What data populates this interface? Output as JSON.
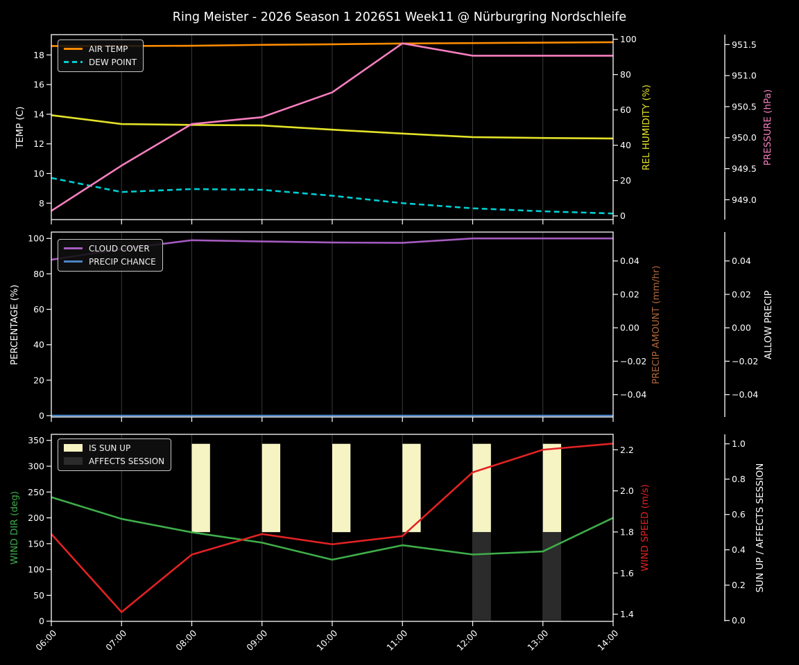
{
  "title": "Ring Meister - 2026 Season 1 2026S1 Week11 @ Nürburgring Nordschleife",
  "x_labels": [
    "06:00",
    "07:00",
    "08:00",
    "09:00",
    "10:00",
    "11:00",
    "12:00",
    "13:00",
    "14:00"
  ],
  "colors": {
    "background": "#000000",
    "foreground": "#ffffff",
    "grid": "#3a3a3a",
    "air_temp": "#ff8c00",
    "dew_point": "#00ced1",
    "rel_humidity": "#e3e328",
    "pressure": "#f77fbf",
    "cloud_cover": "#a55bc0",
    "precip_chance": "#4a85c7",
    "precip_amount": "#b0663a",
    "wind_dir": "#3fae4a",
    "wind_speed": "#e32222",
    "is_sun_up": "#f7f4c4",
    "affects_session": "#2b2b2b"
  },
  "chart_data": [
    {
      "type": "line",
      "panel": "temperature-humidity-pressure",
      "x": [
        "06:00",
        "07:00",
        "08:00",
        "09:00",
        "10:00",
        "11:00",
        "12:00",
        "13:00",
        "14:00"
      ],
      "legend": [
        {
          "label": "AIR TEMP",
          "swatch": "line",
          "color": "#ff8c00"
        },
        {
          "label": "DEW POINT",
          "swatch": "dashed",
          "color": "#00ced1"
        }
      ],
      "left_axis": {
        "title": "TEMP (C)",
        "title_color": "#ffffff",
        "tick_labels": [
          "8",
          "10",
          "12",
          "14",
          "16",
          "18"
        ],
        "tick_values": [
          8,
          10,
          12,
          14,
          16,
          18
        ],
        "range": [
          6.89,
          19.37
        ]
      },
      "right_axis1": {
        "title": "REL HUMIDITY (%)",
        "title_color": "#e3e328",
        "tick_labels": [
          "0",
          "20",
          "40",
          "60",
          "80",
          "100"
        ],
        "tick_values": [
          0,
          20,
          40,
          60,
          80,
          100
        ],
        "range": [
          -2.08,
          102.6
        ]
      },
      "right_axis2": {
        "title": "PRESSURE (hPa)",
        "title_color": "#f77fbf",
        "tick_labels": [
          "949.0",
          "949.5",
          "950.0",
          "950.5",
          "951.0",
          "951.5"
        ],
        "tick_values": [
          949.0,
          949.5,
          950.0,
          950.5,
          951.0,
          951.5
        ],
        "range": [
          948.68,
          951.66
        ]
      },
      "series": [
        {
          "name": "AIR TEMP",
          "axis": "left",
          "color": "#ff8c00",
          "dash": false,
          "values": [
            18.6,
            18.6,
            18.62,
            18.68,
            18.72,
            18.77,
            18.8,
            18.83,
            18.86
          ]
        },
        {
          "name": "DEW POINT",
          "axis": "left",
          "color": "#00ced1",
          "dash": true,
          "values": [
            9.7,
            8.75,
            8.95,
            8.9,
            8.5,
            8.0,
            7.65,
            7.45,
            7.3
          ]
        },
        {
          "name": "REL HUMIDITY",
          "axis": "right1",
          "color": "#e3e328",
          "dash": false,
          "values": [
            57,
            52,
            51.5,
            51.2,
            48.8,
            46.6,
            44.6,
            44.1,
            43.8
          ]
        },
        {
          "name": "PRESSURE",
          "axis": "right2",
          "color": "#f77fbf",
          "dash": false,
          "values": [
            948.82,
            949.55,
            950.22,
            950.33,
            950.73,
            951.52,
            951.32,
            951.32,
            951.32
          ]
        }
      ]
    },
    {
      "type": "line",
      "panel": "cloud-precip",
      "x": [
        "06:00",
        "07:00",
        "08:00",
        "09:00",
        "10:00",
        "11:00",
        "12:00",
        "13:00",
        "14:00"
      ],
      "legend": [
        {
          "label": "CLOUD COVER",
          "swatch": "line",
          "color": "#a55bc0"
        },
        {
          "label": "PRECIP CHANCE",
          "swatch": "line",
          "color": "#4a85c7"
        }
      ],
      "left_axis": {
        "title": "PERCENTAGE (%)",
        "title_color": "#ffffff",
        "tick_labels": [
          "0",
          "20",
          "40",
          "60",
          "80",
          "100"
        ],
        "tick_values": [
          0,
          20,
          40,
          60,
          80,
          100
        ],
        "range": [
          -0.78,
          103.6
        ]
      },
      "right_axis1": {
        "title": "PRECIP AMOUNT (mm/hr)",
        "title_color": "#b0663a",
        "tick_labels": [
          "−0.04",
          "−0.02",
          "0.00",
          "0.02",
          "0.04"
        ],
        "tick_values": [
          -0.04,
          -0.02,
          0,
          0.02,
          0.04
        ],
        "range": [
          -0.0534,
          0.0573
        ]
      },
      "right_axis2": {
        "title": "ALLOW PRECIP",
        "title_color": "#ffffff",
        "tick_labels": [
          "−0.04",
          "−0.02",
          "0.00",
          "0.02",
          "0.04"
        ],
        "tick_values": [
          -0.04,
          -0.02,
          0,
          0.02,
          0.04
        ],
        "range": [
          -0.0534,
          0.0573
        ]
      },
      "series": [
        {
          "name": "CLOUD COVER",
          "axis": "left",
          "color": "#a55bc0",
          "dash": false,
          "values": [
            88,
            94,
            99,
            98.3,
            97.7,
            97.5,
            100,
            100,
            100
          ]
        },
        {
          "name": "PRECIP CHANCE",
          "axis": "left",
          "color": "#4a85c7",
          "dash": false,
          "values": [
            0,
            0,
            0,
            0,
            0,
            0,
            0,
            0,
            0
          ]
        }
      ]
    },
    {
      "type": "line-bar",
      "panel": "wind-sun",
      "x": [
        "06:00",
        "07:00",
        "08:00",
        "09:00",
        "10:00",
        "11:00",
        "12:00",
        "13:00",
        "14:00"
      ],
      "legend": [
        {
          "label": "IS SUN UP",
          "swatch": "rect",
          "color": "#f7f4c4"
        },
        {
          "label": "AFFECTS SESSION",
          "swatch": "rect",
          "color": "#2b2b2b"
        }
      ],
      "left_axis": {
        "title": "WIND DIR (deg)",
        "title_color": "#3fae4a",
        "tick_labels": [
          "0",
          "50",
          "100",
          "150",
          "200",
          "250",
          "300",
          "350"
        ],
        "tick_values": [
          0,
          50,
          100,
          150,
          200,
          250,
          300,
          350
        ],
        "range": [
          -0.4,
          361.7
        ]
      },
      "right_axis1": {
        "title": "WIND SPEED (m/s)",
        "title_color": "#e32222",
        "tick_labels": [
          "1.4",
          "1.6",
          "1.8",
          "2.0",
          "2.2"
        ],
        "tick_values": [
          1.4,
          1.6,
          1.8,
          2.0,
          2.2
        ],
        "range": [
          1.365,
          2.275
        ]
      },
      "right_axis2": {
        "title": "SUN UP / AFFECTS SESSION",
        "title_color": "#ffffff",
        "tick_labels": [
          "0.0",
          "0.2",
          "0.4",
          "0.6",
          "0.8",
          "1.0"
        ],
        "tick_values": [
          0,
          0.2,
          0.4,
          0.6,
          0.8,
          1.0
        ],
        "range": [
          -0.0051,
          1.0537
        ]
      },
      "series": [
        {
          "name": "WIND DIR",
          "axis": "left",
          "color": "#3fae4a",
          "dash": false,
          "values": [
            240,
            198,
            172,
            152,
            119,
            147,
            129,
            135,
            200
          ]
        },
        {
          "name": "WIND SPEED",
          "axis": "right1",
          "color": "#e32222",
          "dash": false,
          "values": [
            1.79,
            1.41,
            1.69,
            1.79,
            1.74,
            1.78,
            2.09,
            2.2,
            2.23
          ]
        }
      ],
      "bars": [
        {
          "name": "IS SUN UP",
          "axis": "right2",
          "color": "#f7f4c4",
          "bottom": 0.5,
          "top": 1.0,
          "values": [
            0,
            0,
            1,
            1,
            1,
            1,
            1,
            1,
            0
          ]
        },
        {
          "name": "AFFECTS SESSION",
          "axis": "right2",
          "color": "#2b2b2b",
          "bottom": 0.0,
          "top": 0.5,
          "values": [
            0,
            0,
            0,
            0,
            0,
            0,
            1,
            1,
            0
          ]
        }
      ]
    }
  ]
}
